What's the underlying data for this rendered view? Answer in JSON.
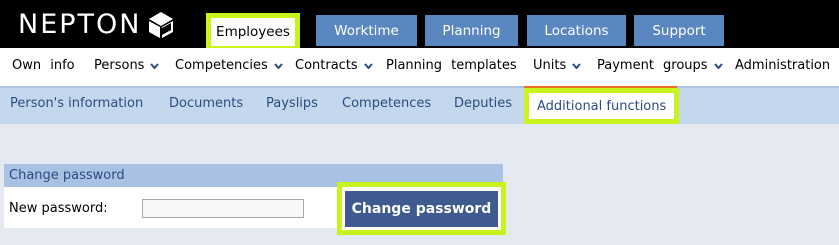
{
  "brand": {
    "name": "NEPTON",
    "logo_icon": "nepton-cube-logo"
  },
  "main_tabs": [
    {
      "label": "Employees",
      "active": true
    },
    {
      "label": "Worktime",
      "active": false
    },
    {
      "label": "Planning",
      "active": false
    },
    {
      "label": "Locations",
      "active": false
    },
    {
      "label": "Support",
      "active": false
    }
  ],
  "menu": [
    {
      "label": "Own info",
      "dropdown": false
    },
    {
      "label": "Persons",
      "dropdown": true
    },
    {
      "label": "Competencies",
      "dropdown": true
    },
    {
      "label": "Contracts",
      "dropdown": true
    },
    {
      "label": "Planning templates",
      "dropdown": false
    },
    {
      "label": "Units",
      "dropdown": true
    },
    {
      "label": "Payment groups",
      "dropdown": true
    },
    {
      "label": "Administration",
      "dropdown": false
    }
  ],
  "sub_tabs": [
    {
      "label": "Person's information",
      "active": false
    },
    {
      "label": "Documents",
      "active": false
    },
    {
      "label": "Payslips",
      "active": false
    },
    {
      "label": "Competences",
      "active": false
    },
    {
      "label": "Deputies",
      "active": false
    },
    {
      "label": "Additional functions",
      "active": true
    }
  ],
  "change_password": {
    "header": "Change password",
    "field_label": "New password:",
    "value": "",
    "button_label": "Change password"
  },
  "colors": {
    "tab_blue": "#5b87c1",
    "highlight": "#c8f31d",
    "subrow_blue": "#c5d7ec",
    "button_blue": "#3f5a8f",
    "active_accent": "#e9711e"
  }
}
